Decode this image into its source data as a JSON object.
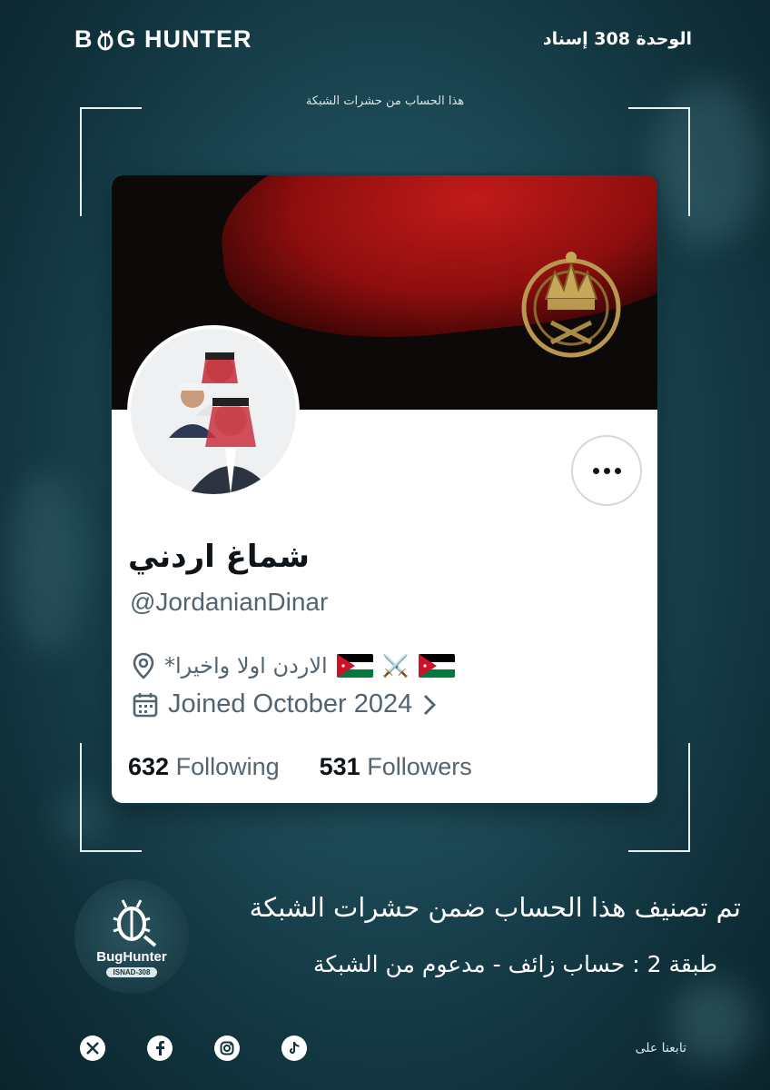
{
  "header": {
    "brand_left": "B",
    "brand_right": "G HUNTER",
    "unit": "الوحدة 308 إسناد",
    "subtitle": "هذا الحساب من حشرات الشبكة"
  },
  "profile": {
    "display_name": "شماغ اردني",
    "handle": "@JordanianDinar",
    "location": "الاردن اولا واخيرا*",
    "location_decor": "⚔️",
    "joined": "Joined October 2024",
    "following_count": "632",
    "following_label": "Following",
    "followers_count": "531",
    "followers_label": "Followers"
  },
  "icons": {
    "location": "location-pin-icon",
    "calendar": "calendar-icon",
    "chevron": "chevron-right-icon",
    "more": "more-options-icon"
  },
  "footer": {
    "logo_title": "BugHunter",
    "logo_pill": "ISNAD-308",
    "classified": "تم تصنيف هذا الحساب ضمن حشرات الشبكة",
    "tier": "طبقة 2 : حساب زائف - مدعوم من الشبكة",
    "follow_us": "تابعنا على",
    "social": [
      "X",
      "f",
      "ig",
      "tiktok"
    ]
  },
  "colors": {
    "background": "#1d4a57",
    "card_text": "#0f1419",
    "muted_text": "#536471",
    "jordan_red": "#ce1126",
    "jordan_green": "#007a3d"
  }
}
